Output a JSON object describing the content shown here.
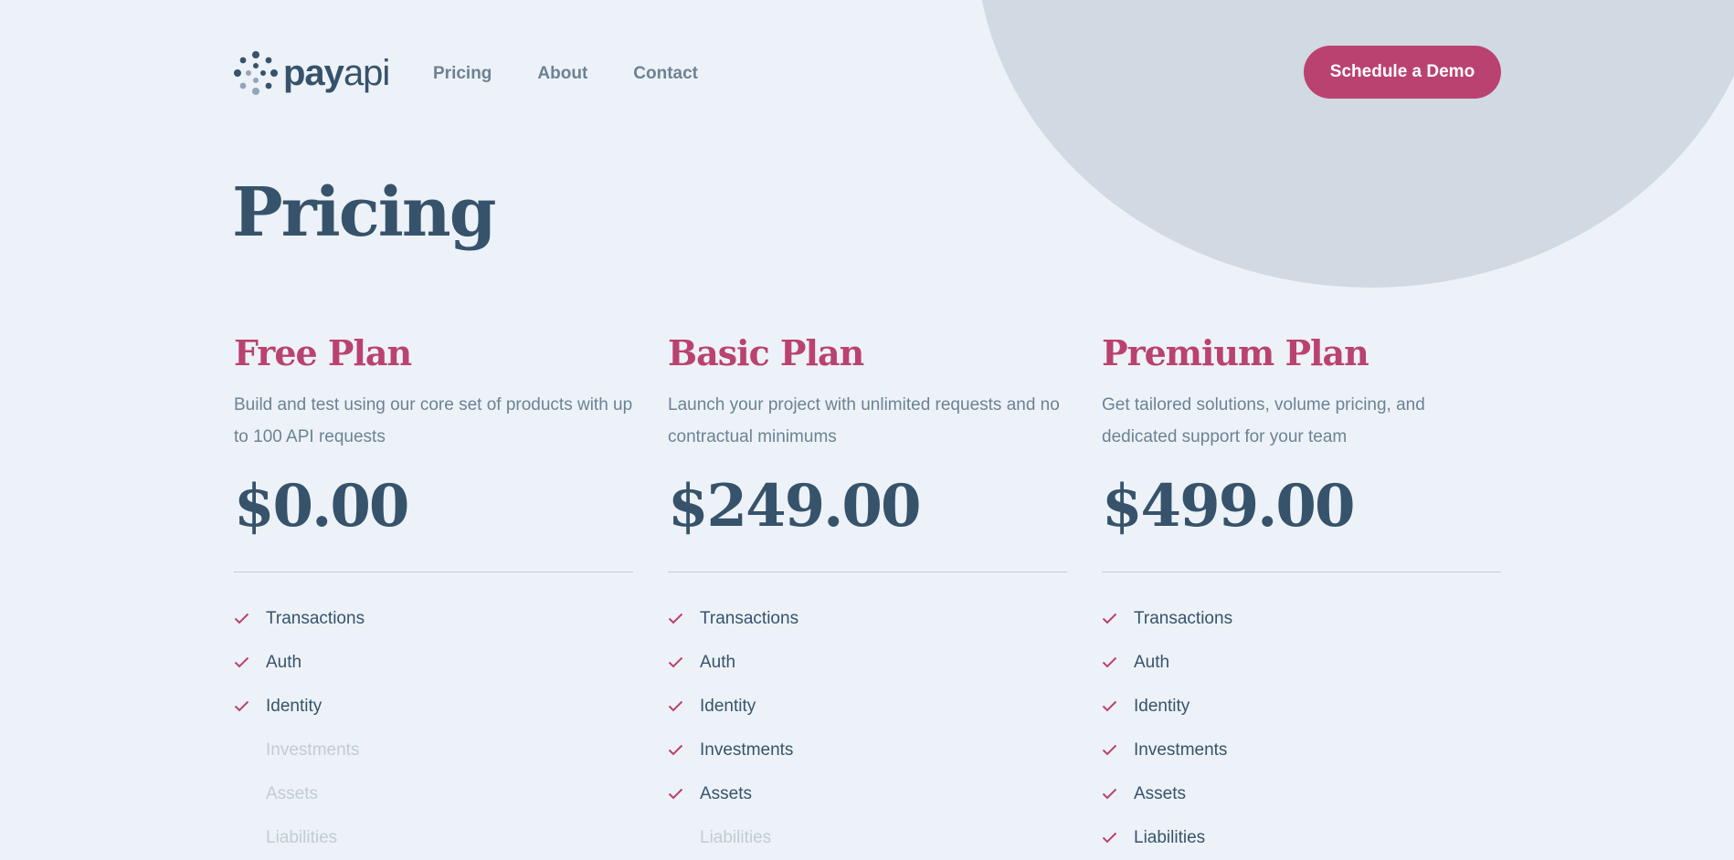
{
  "brand": {
    "logo_bold": "pay",
    "logo_light": "api"
  },
  "nav": {
    "items": [
      {
        "label": "Pricing"
      },
      {
        "label": "About"
      },
      {
        "label": "Contact"
      }
    ]
  },
  "cta": {
    "label": "Schedule a Demo"
  },
  "page": {
    "title": "Pricing"
  },
  "plans": [
    {
      "name": "Free Plan",
      "description": "Build and test using our core set of products with up to 100 API requests",
      "price": "$0.00",
      "features": [
        {
          "label": "Transactions",
          "included": true
        },
        {
          "label": "Auth",
          "included": true
        },
        {
          "label": "Identity",
          "included": true
        },
        {
          "label": "Investments",
          "included": false
        },
        {
          "label": "Assets",
          "included": false
        },
        {
          "label": "Liabilities",
          "included": false
        }
      ]
    },
    {
      "name": "Basic Plan",
      "description": "Launch your project with unlimited requests and no contractual minimums",
      "price": "$249.00",
      "features": [
        {
          "label": "Transactions",
          "included": true
        },
        {
          "label": "Auth",
          "included": true
        },
        {
          "label": "Identity",
          "included": true
        },
        {
          "label": "Investments",
          "included": true
        },
        {
          "label": "Assets",
          "included": true
        },
        {
          "label": "Liabilities",
          "included": false
        }
      ]
    },
    {
      "name": "Premium Plan",
      "description": "Get tailored solutions, volume pricing, and dedicated support for your team",
      "price": "$499.00",
      "features": [
        {
          "label": "Transactions",
          "included": true
        },
        {
          "label": "Auth",
          "included": true
        },
        {
          "label": "Identity",
          "included": true
        },
        {
          "label": "Investments",
          "included": true
        },
        {
          "label": "Assets",
          "included": true
        },
        {
          "label": "Liabilities",
          "included": true
        }
      ]
    }
  ],
  "colors": {
    "background": "#edf2f8",
    "circle": "#d1d9e2",
    "accent": "#ba4270",
    "heading": "#36536b",
    "body_text": "#6c8294",
    "disabled_text": "#c0ccd6",
    "divider": "#c2ccd6"
  },
  "icons": {
    "logo": "dot-cluster-logo-icon",
    "included": "checkmark-icon"
  }
}
